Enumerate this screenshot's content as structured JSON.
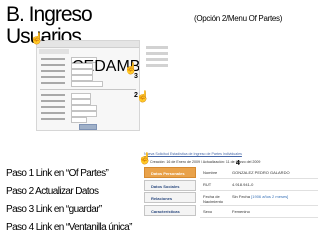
{
  "title": "B. Ingreso\nUsuarios",
  "subtitle": "(Opción 2/Menu Of Partes)",
  "markers": {
    "one": "1",
    "two": "2",
    "three": "3",
    "four": "4"
  },
  "form": {
    "rows": 8,
    "hint_values": [
      "CEDAMB",
      "JEREMIAS",
      "PACHECO",
      "ZUÑIGA",
      "",
      "",
      "METROPOLITANA",
      "CONSTITUCIÓN"
    ]
  },
  "breadcrumb": "Nueva Solicitud Estadística de Ingreso de Partes Individuales",
  "meta_line": "Creación: 16 de Enero de 2009 / Actualización: 11 de Marzo del 2009",
  "side_menu": [
    "Datos Personales",
    "Datos Sociales",
    "Relaciones",
    "Características"
  ],
  "detail_rows": [
    {
      "label": "Nombre",
      "value": "GONZALEZ PEDRO GALARDO",
      "hint": ""
    },
    {
      "label": "RUT",
      "value": "4.918.941-0",
      "hint": ""
    },
    {
      "label": "Fecha de Nacimiento",
      "value": "Sin Fecha",
      "hint": "[1906 años 2 meses]"
    },
    {
      "label": "Sexo",
      "value": "Femenino",
      "hint": ""
    }
  ],
  "steps": [
    "Paso 1 Link en “Of Partes”",
    "Paso 2 Actualizar Datos",
    "Paso 3 Link en “guardar”",
    "Paso 4 Link en “Ventanilla única”"
  ],
  "colors": {
    "active_menu": "#e9a24a",
    "link": "#4466a8"
  }
}
